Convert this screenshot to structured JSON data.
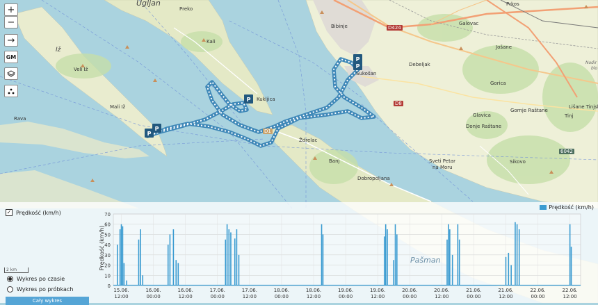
{
  "map_controls": {
    "zoom_in": "+",
    "zoom_out": "−",
    "route_arrow": "→",
    "provider": "GM",
    "layers_icon": "layers-icon",
    "points_icon": "points-icon"
  },
  "places": {
    "ugljan": "Ugljan",
    "preko": "Preko",
    "il": "Iž",
    "veli_iz": "Veli Iž",
    "mali_iz": "Mali Iž",
    "rava": "Rava",
    "kali": "Kali",
    "kukljica": "Kukljica",
    "bibinje": "Bibinje",
    "sukosan": "Sukošan",
    "debeljak": "Debeljak",
    "galovac": "Galovac",
    "prkos": "Prkos",
    "josane": "Jošane",
    "gorica": "Gorica",
    "glavica": "Glavica",
    "donje_rastane": "Donje Raštane",
    "gornje_rastane": "Gornje Raštane",
    "lisane": "Lišane Tinjske",
    "tinj": "Tinj",
    "zdrelac": "Ždrelac",
    "banj": "Banj",
    "dobropoljana": "Dobropoljana",
    "sveti_petar": "Sveti Petar",
    "na_moru": "na Moru",
    "sikovo": "Sikovo",
    "pasman": "Pašman",
    "nodi": "Nodir",
    "blo": "blo"
  },
  "roads": {
    "d424": "D424",
    "d8": "D8",
    "d110": "D1",
    "r6042": "6042"
  },
  "markers": {
    "parking": "P"
  },
  "panel": {
    "checkbox_label": "Prędkość (km/h)",
    "checkbox_checked": true,
    "radio_time": "Wykres po czasie",
    "radio_samples": "Wykres po próbkach",
    "selected_mode": "time",
    "reset_button": "Cały wykres",
    "scale_label": "2 km"
  },
  "chart_data": {
    "type": "bar",
    "title": "",
    "xlabel": "",
    "ylabel": "Prędkość (km/h)",
    "ylim": [
      0,
      70
    ],
    "y_ticks": [
      0,
      10,
      20,
      30,
      40,
      50,
      60,
      70
    ],
    "x_tick_labels": [
      [
        "15.06.",
        "12:00"
      ],
      [
        "16.06.",
        "00:00"
      ],
      [
        "16.06.",
        "12:00"
      ],
      [
        "17.06.",
        "00:00"
      ],
      [
        "17.06.",
        "12:00"
      ],
      [
        "18.06.",
        "00:00"
      ],
      [
        "18.06.",
        "12:00"
      ],
      [
        "19.06.",
        "00:00"
      ],
      [
        "19.06.",
        "12:00"
      ],
      [
        "20.06.",
        "00:00"
      ],
      [
        "20.06.",
        "12:00"
      ],
      [
        "21.06.",
        "00:00"
      ],
      [
        "21.06.",
        "12:00"
      ],
      [
        "22.06.",
        "00:00"
      ],
      [
        "22.06.",
        "12:00"
      ]
    ],
    "x_unit": "hours since 15.06. 12:00",
    "series": [
      {
        "name": "Prędkość (km/h)",
        "color": "#3a9bd1",
        "spikes": [
          [
            -1.5,
            40
          ],
          [
            -0.5,
            55
          ],
          [
            0.0,
            60
          ],
          [
            0.5,
            58
          ],
          [
            1.0,
            22
          ],
          [
            2.0,
            5
          ],
          [
            6.5,
            45
          ],
          [
            7.2,
            55
          ],
          [
            8.0,
            10
          ],
          [
            17.5,
            40
          ],
          [
            18.2,
            50
          ],
          [
            19.5,
            55
          ],
          [
            20.5,
            25
          ],
          [
            21.3,
            22
          ],
          [
            39.0,
            45
          ],
          [
            39.6,
            60
          ],
          [
            40.3,
            55
          ],
          [
            41.0,
            52
          ],
          [
            42.5,
            46
          ],
          [
            43.2,
            55
          ],
          [
            44.0,
            30
          ],
          [
            75.0,
            60
          ],
          [
            75.5,
            50
          ],
          [
            98.5,
            48
          ],
          [
            99.0,
            60
          ],
          [
            99.6,
            55
          ],
          [
            102.0,
            25
          ],
          [
            102.6,
            60
          ],
          [
            103.2,
            50
          ],
          [
            122.0,
            45
          ],
          [
            122.5,
            60
          ],
          [
            123.0,
            55
          ],
          [
            124.0,
            30
          ],
          [
            126.0,
            60
          ],
          [
            126.6,
            45
          ],
          [
            144.0,
            28
          ],
          [
            145.0,
            32
          ],
          [
            146.0,
            20
          ],
          [
            147.5,
            62
          ],
          [
            148.2,
            60
          ],
          [
            149.0,
            55
          ],
          [
            168.0,
            60
          ],
          [
            168.5,
            38
          ]
        ]
      }
    ],
    "legend_position": "top-right",
    "grid": true
  }
}
